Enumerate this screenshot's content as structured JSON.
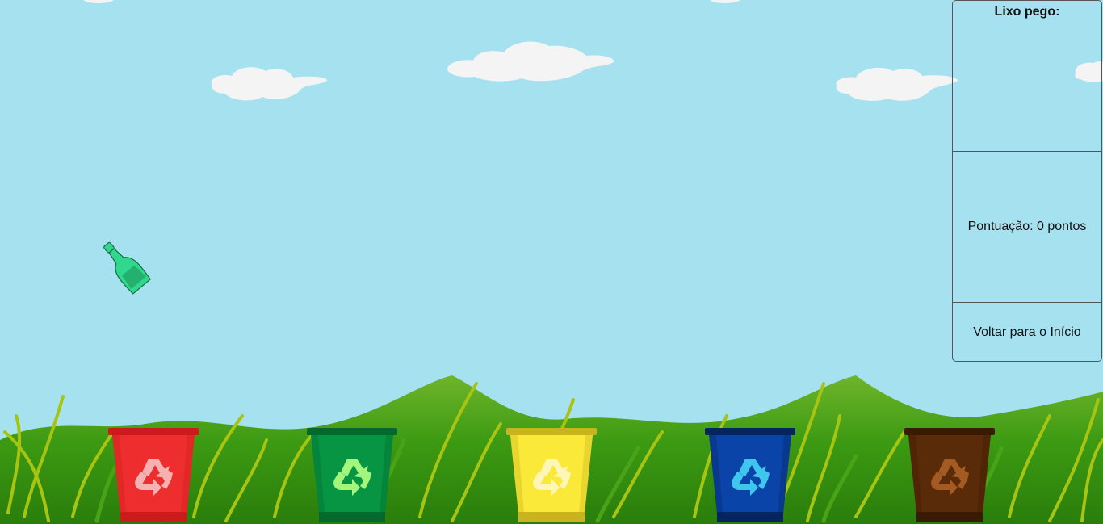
{
  "panel": {
    "caught_title": "Lixo pego:",
    "score_label": "Pontuação:",
    "score_value": "0",
    "score_unit": "pontos",
    "back_label": "Voltar para o Início"
  },
  "bins": [
    {
      "name": "bin-red",
      "color": "#ee2e2e",
      "rim": "#cc1b1b",
      "symbol": "#f6b2b2"
    },
    {
      "name": "bin-green",
      "color": "#079544",
      "rim": "#04682f",
      "symbol": "#a3f57c"
    },
    {
      "name": "bin-yellow",
      "color": "#fbe93a",
      "rim": "#c9b31e",
      "symbol": "#fff6b8"
    },
    {
      "name": "bin-blue",
      "color": "#0b44a8",
      "rim": "#06245f",
      "symbol": "#3fc6ef"
    },
    {
      "name": "bin-brown",
      "color": "#5a2b08",
      "rim": "#3b1a03",
      "symbol": "#a45a23"
    }
  ],
  "falling_item": {
    "icon": "glass-bottle-icon",
    "color": "#2fd88c"
  },
  "colors": {
    "sky": "#a6e1f0",
    "grass": "#3c9a12"
  }
}
